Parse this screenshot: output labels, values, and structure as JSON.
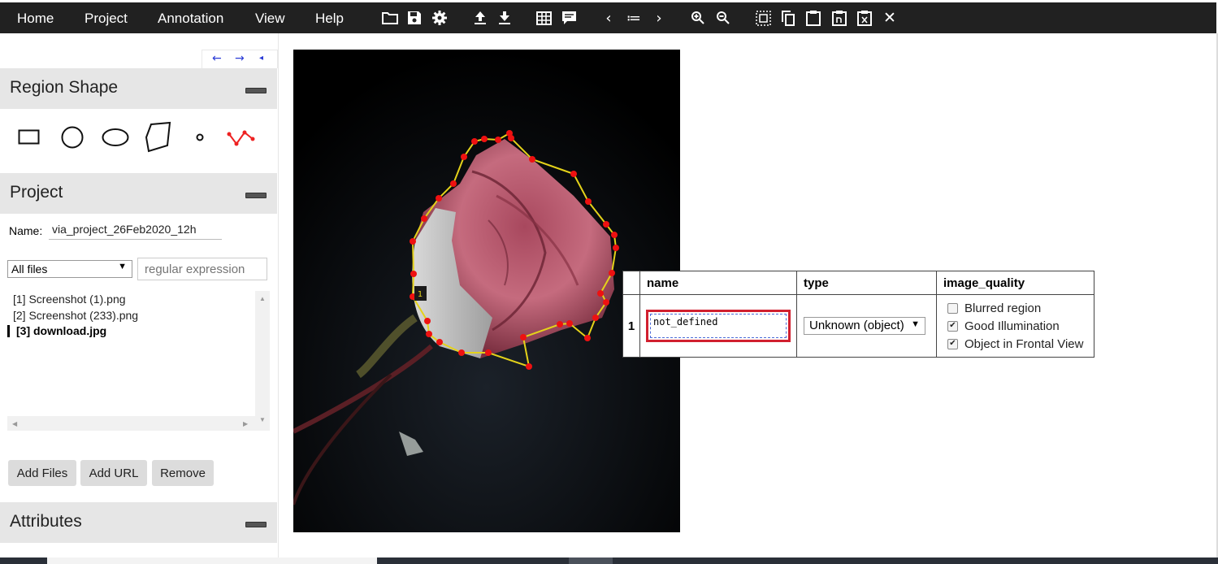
{
  "menu": [
    "Home",
    "Project",
    "Annotation",
    "View",
    "Help"
  ],
  "toolbar": {
    "icons": [
      "folder-open-icon",
      "save-icon",
      "settings-icon",
      "upload-icon",
      "download-icon",
      "grid-icon",
      "comment-icon",
      "prev-icon",
      "list-icon",
      "next-icon",
      "zoom-in-icon",
      "zoom-out-icon",
      "select-all-icon",
      "copy-icon",
      "paste-icon",
      "paste-n-icon",
      "delete-region-icon",
      "close-icon"
    ],
    "close_glyph": "✕",
    "prev_glyph": "‹",
    "next_glyph": "›",
    "list_glyph": "≔"
  },
  "sidebar": {
    "nav_arrows": {
      "left": "←",
      "right": "→",
      "collapse": "◂"
    },
    "region_shape": {
      "title": "Region Shape",
      "shapes": [
        "rectangle",
        "circle",
        "ellipse",
        "polygon",
        "point",
        "polyline"
      ]
    },
    "project": {
      "title": "Project",
      "name_label": "Name:",
      "name_value": "via_project_26Feb2020_12h",
      "filter_selected": "All files",
      "regex_placeholder": "regular expression",
      "files": [
        "[1] Screenshot (1).png",
        "[2] Screenshot (233).png",
        "[3] download.jpg"
      ],
      "active_index": 2,
      "buttons": {
        "add_files": "Add Files",
        "add_url": "Add URL",
        "remove": "Remove"
      }
    },
    "attributes": {
      "title": "Attributes"
    }
  },
  "canvas": {
    "region_label": "1",
    "region_stroke": "#e4d21a",
    "vertex_color": "#ee1111"
  },
  "annotation_table": {
    "headers": [
      "name",
      "type",
      "image_quality"
    ],
    "row_index": "1",
    "name_value": "not_defined",
    "type_selected": "Unknown (object)",
    "image_quality": [
      {
        "label": "Blurred region",
        "checked": false
      },
      {
        "label": "Good Illumination",
        "checked": true
      },
      {
        "label": "Object in Frontal View",
        "checked": true
      }
    ]
  },
  "check_glyph": "✔",
  "caret_glyph": "▼",
  "colors": {
    "topbar": "#212121",
    "section": "#e6e6e6",
    "highlight": "#d1202f"
  }
}
